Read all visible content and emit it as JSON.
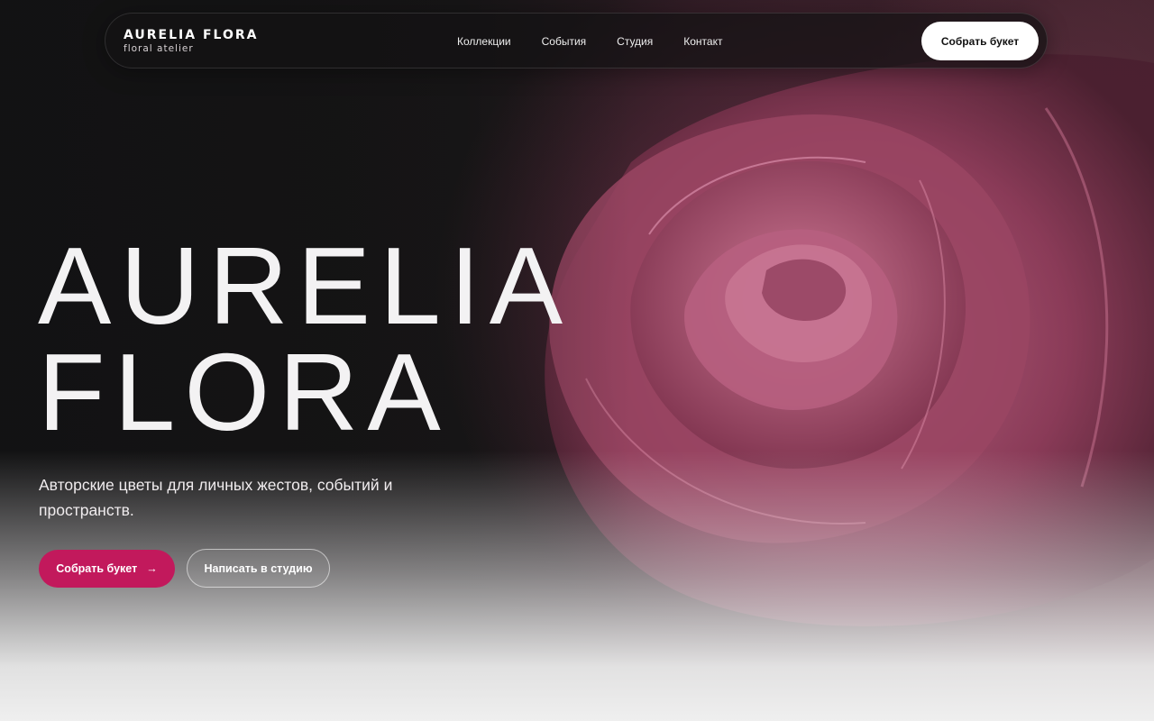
{
  "brand": {
    "name": "AURELIA FLORA",
    "tagline": "floral atelier"
  },
  "nav": {
    "items": [
      {
        "label": "Коллекции"
      },
      {
        "label": "События"
      },
      {
        "label": "Студия"
      },
      {
        "label": "Контакт"
      }
    ],
    "cta_label": "Собрать букет"
  },
  "hero": {
    "title_line1": "AURELIA",
    "title_line2": "FLORA",
    "subtitle": "Авторские цветы для личных жестов, событий и пространств.",
    "primary_label": "Собрать букет",
    "primary_arrow": "→",
    "secondary_label": "Написать в студию"
  },
  "colors": {
    "accent": "#c2195c",
    "background": "#131314",
    "rose": "#a54e6c"
  },
  "images": {
    "hero_background": "rose-photo"
  }
}
